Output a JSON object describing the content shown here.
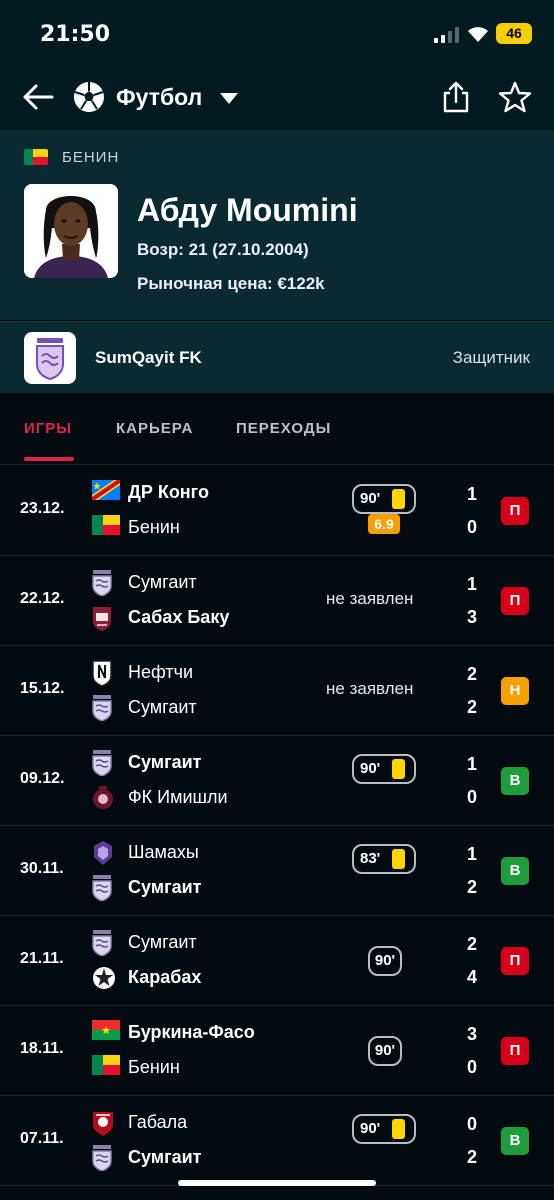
{
  "status_bar": {
    "time": "21:50",
    "battery": "46"
  },
  "header": {
    "sport": "Футбол"
  },
  "player": {
    "country": "БЕНИН",
    "name": "Абду Moumini",
    "age": "Возр: 21 (27.10.2004)",
    "market_value": "Рыночная цена: €122k"
  },
  "club": {
    "name": "SumQayit FK",
    "position": "Защитник"
  },
  "tabs": [
    "ИГРЫ",
    "КАРЬЕРА",
    "ПЕРЕХОДЫ"
  ],
  "matches": [
    {
      "date": "23.12.",
      "home": "ДР Конго",
      "away": "Бенин",
      "home_flag": "drc",
      "away_flag": "benin",
      "home_bold": true,
      "away_bold": false,
      "minutes": "90'",
      "card": true,
      "rating": "6.9",
      "note": "",
      "score_home": "1",
      "score_away": "0",
      "result": "П",
      "result_type": "l"
    },
    {
      "date": "22.12.",
      "home": "Сумгаит",
      "away": "Сабах Баку",
      "home_flag": "sumqayit",
      "away_flag": "sabah",
      "home_bold": false,
      "away_bold": true,
      "minutes": "",
      "card": false,
      "rating": "",
      "note": "не заявлен",
      "score_home": "1",
      "score_away": "3",
      "result": "П",
      "result_type": "l"
    },
    {
      "date": "15.12.",
      "home": "Нефтчи",
      "away": "Сумгаит",
      "home_flag": "neftchi",
      "away_flag": "sumqayit",
      "home_bold": false,
      "away_bold": false,
      "minutes": "",
      "card": false,
      "rating": "",
      "note": "не заявлен",
      "score_home": "2",
      "score_away": "2",
      "result": "Н",
      "result_type": "d"
    },
    {
      "date": "09.12.",
      "home": "Сумгаит",
      "away": "ФК Имишли",
      "home_flag": "sumqayit",
      "away_flag": "imishli",
      "home_bold": true,
      "away_bold": false,
      "minutes": "90'",
      "card": true,
      "rating": "",
      "note": "",
      "score_home": "1",
      "score_away": "0",
      "result": "В",
      "result_type": "w"
    },
    {
      "date": "30.11.",
      "home": "Шамахы",
      "away": "Сумгаит",
      "home_flag": "shamakhi",
      "away_flag": "sumqayit",
      "home_bold": false,
      "away_bold": true,
      "minutes": "83'",
      "card": true,
      "rating": "",
      "note": "",
      "score_home": "1",
      "score_away": "2",
      "result": "В",
      "result_type": "w"
    },
    {
      "date": "21.11.",
      "home": "Сумгаит",
      "away": "Карабах",
      "home_flag": "sumqayit",
      "away_flag": "qarabag",
      "home_bold": false,
      "away_bold": true,
      "minutes": "90'",
      "card": false,
      "rating": "",
      "note": "",
      "score_home": "2",
      "score_away": "4",
      "result": "П",
      "result_type": "l"
    },
    {
      "date": "18.11.",
      "home": "Буркина-Фасо",
      "away": "Бенин",
      "home_flag": "burkina",
      "away_flag": "benin",
      "home_bold": true,
      "away_bold": false,
      "minutes": "90'",
      "card": false,
      "rating": "",
      "note": "",
      "score_home": "3",
      "score_away": "0",
      "result": "П",
      "result_type": "l"
    },
    {
      "date": "07.11.",
      "home": "Габала",
      "away": "Сумгаит",
      "home_flag": "gabala",
      "away_flag": "sumqayit",
      "home_bold": false,
      "away_bold": true,
      "minutes": "90'",
      "card": true,
      "rating": "",
      "note": "",
      "score_home": "0",
      "score_away": "2",
      "result": "В",
      "result_type": "w"
    }
  ]
}
